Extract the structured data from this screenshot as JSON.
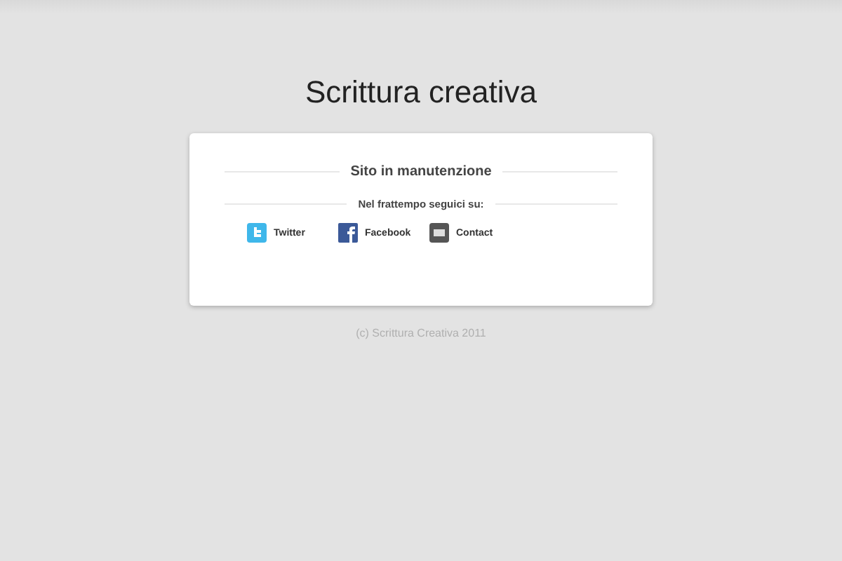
{
  "title": "Scrittura creativa",
  "card": {
    "heading": "Sito in manutenzione",
    "subheading": "Nel frattempo seguici su:",
    "links": [
      {
        "kind": "twitter",
        "label": "Twitter"
      },
      {
        "kind": "facebook",
        "label": "Facebook"
      },
      {
        "kind": "contact",
        "label": "Contact"
      }
    ]
  },
  "footer": "(c) Scrittura Creativa 2011"
}
